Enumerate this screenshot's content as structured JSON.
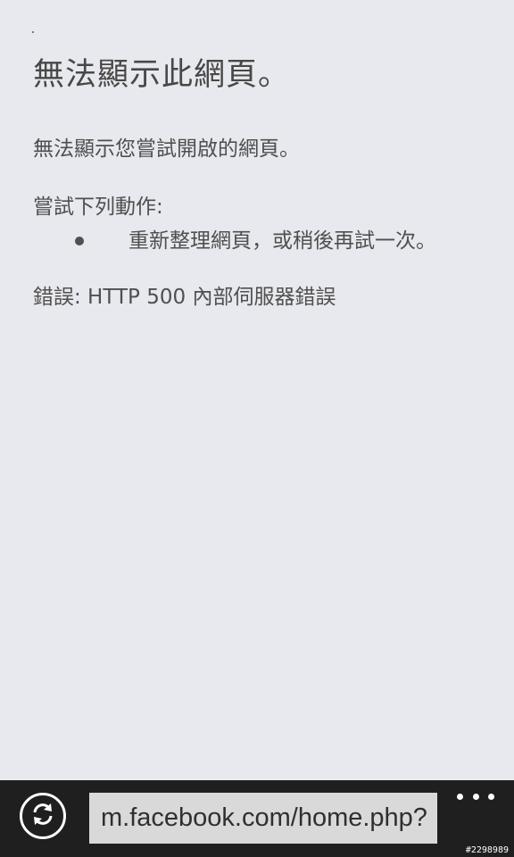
{
  "page": {
    "title": "無法顯示此網頁。",
    "description": "無法顯示您嘗試開啟的網頁。",
    "try_heading": "嘗試下列動作:",
    "suggestions": [
      "重新整理網頁，或稍後再試一次。"
    ],
    "error": "錯誤: HTTP 500 內部伺服器錯誤"
  },
  "appbar": {
    "address": "m.facebook.com/home.php?",
    "refresh_icon": "refresh-icon",
    "more_icon": "ellipsis-icon"
  },
  "watermark": "#2298989"
}
